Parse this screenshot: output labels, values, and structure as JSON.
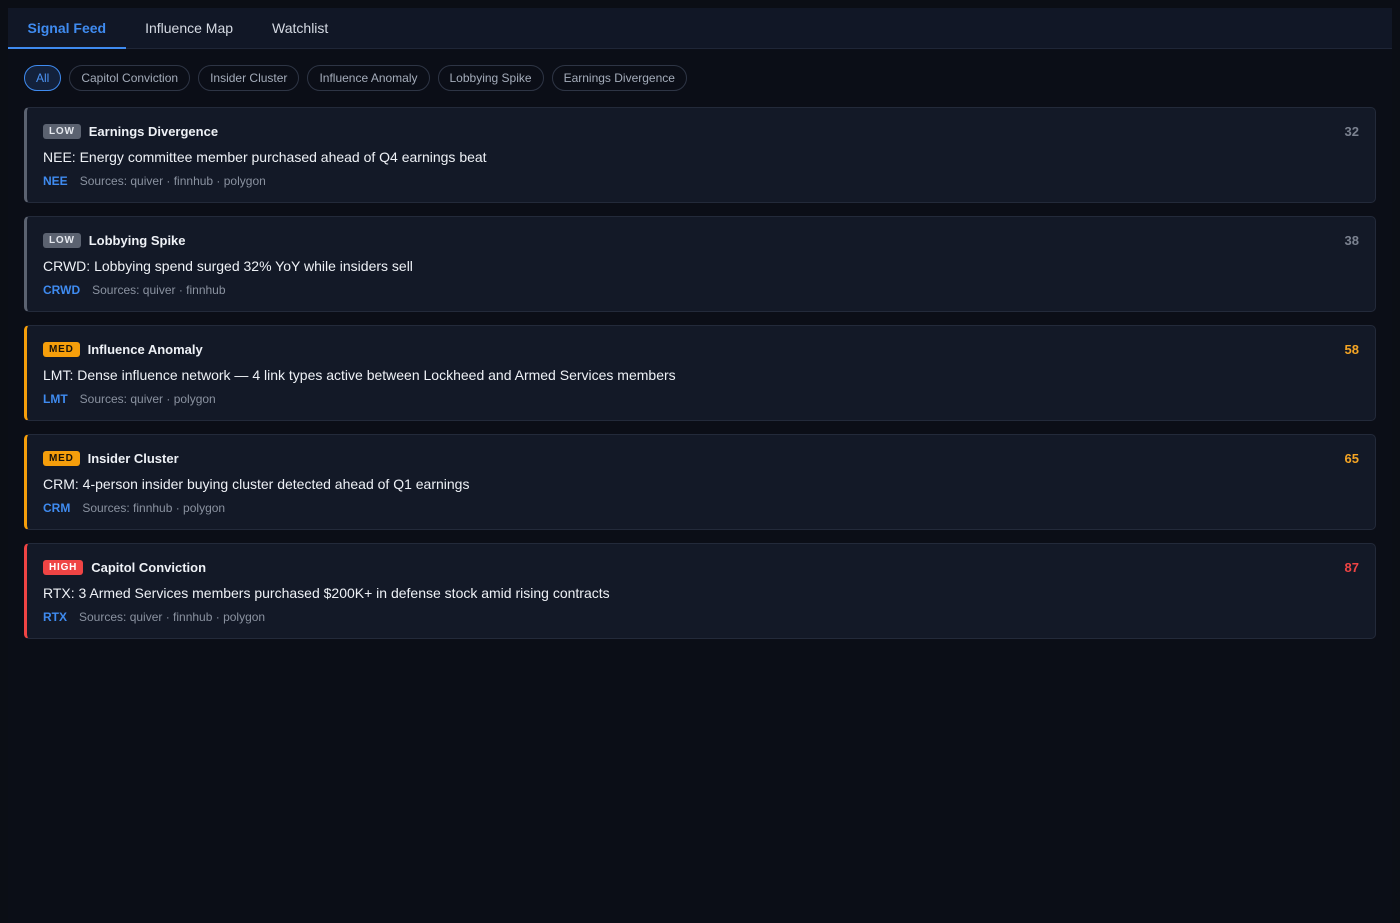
{
  "tabs": [
    {
      "label": "Signal Feed",
      "active": true
    },
    {
      "label": "Influence Map",
      "active": false
    },
    {
      "label": "Watchlist",
      "active": false
    }
  ],
  "filters": [
    {
      "label": "All",
      "active": true
    },
    {
      "label": "Capitol Conviction",
      "active": false
    },
    {
      "label": "Insider Cluster",
      "active": false
    },
    {
      "label": "Influence Anomaly",
      "active": false
    },
    {
      "label": "Lobbying Spike",
      "active": false
    },
    {
      "label": "Earnings Divergence",
      "active": false
    }
  ],
  "signals": [
    {
      "severity": "low",
      "badge": "LOW",
      "type": "Earnings Divergence",
      "score": "32",
      "headline": "NEE: Energy committee member purchased ahead of Q4 earnings beat",
      "ticker": "NEE",
      "sources": "Sources: quiver · finnhub · polygon"
    },
    {
      "severity": "low",
      "badge": "LOW",
      "type": "Lobbying Spike",
      "score": "38",
      "headline": "CRWD: Lobbying spend surged 32% YoY while insiders sell",
      "ticker": "CRWD",
      "sources": "Sources: quiver · finnhub"
    },
    {
      "severity": "med",
      "badge": "MED",
      "type": "Influence Anomaly",
      "score": "58",
      "headline": "LMT: Dense influence network — 4 link types active between Lockheed and Armed Services members",
      "ticker": "LMT",
      "sources": "Sources: quiver · polygon"
    },
    {
      "severity": "med",
      "badge": "MED",
      "type": "Insider Cluster",
      "score": "65",
      "headline": "CRM: 4-person insider buying cluster detected ahead of Q1 earnings",
      "ticker": "CRM",
      "sources": "Sources: finnhub · polygon"
    },
    {
      "severity": "high",
      "badge": "HIGH",
      "type": "Capitol Conviction",
      "score": "87",
      "headline": "RTX: 3 Armed Services members purchased $200K+ in defense stock amid rising contracts",
      "ticker": "RTX",
      "sources": "Sources: quiver · finnhub · polygon"
    }
  ],
  "colors": {
    "accent": "#3f8bf0",
    "low": "#5b6270",
    "med": "#f59e0b",
    "high": "#ef4444",
    "background": "#0b0e17",
    "card": "#131927"
  }
}
